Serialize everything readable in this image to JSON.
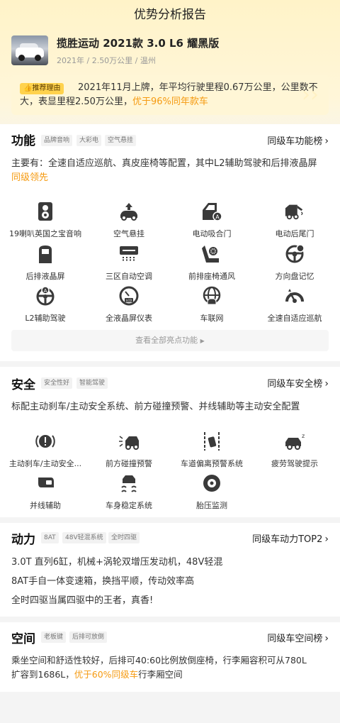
{
  "header": {
    "title": "优势分析报告"
  },
  "car": {
    "name": "揽胜运动 2021款 3.0 L6 耀黑版",
    "meta": "2021年 / 2.50万公里 / 温州"
  },
  "recommend": {
    "badge": "推荐理由",
    "line1": "2021年11月上牌，年平均行驶里程0.67万公里，公里数不",
    "line2_a": "大，表显里程2.50万公里，",
    "line2_hl": "优于96%同年款车"
  },
  "features": {
    "title": "功能",
    "tags": [
      "品牌音响",
      "大彩电",
      "空气悬挂"
    ],
    "rank": "同级车功能榜",
    "summary_line1": "主要有：全速自适应巡航、真皮座椅等配置，其中L2辅助驾驶和后排液晶屏",
    "summary_hl": "同级领先",
    "items": [
      {
        "label": "19喇叭英国之宝音响",
        "icon": "speaker-icon"
      },
      {
        "label": "空气悬挂",
        "icon": "air-suspension-icon"
      },
      {
        "label": "电动吸合门",
        "icon": "power-door-icon"
      },
      {
        "label": "电动后尾门",
        "icon": "power-tailgate-icon"
      },
      {
        "label": "后排液晶屏",
        "icon": "rear-screen-icon"
      },
      {
        "label": "三区自动空调",
        "icon": "climate-icon"
      },
      {
        "label": "前排座椅通风",
        "icon": "seat-ventilation-icon"
      },
      {
        "label": "方向盘记忆",
        "icon": "steering-memory-icon"
      },
      {
        "label": "L2辅助驾驶",
        "icon": "assist-driving-icon"
      },
      {
        "label": "全液晶屏仪表",
        "icon": "lcd-cluster-icon"
      },
      {
        "label": "车联网",
        "icon": "connected-car-icon"
      },
      {
        "label": "全速自适应巡航",
        "icon": "adaptive-cruise-icon"
      }
    ],
    "more": "查看全部亮点功能"
  },
  "safety": {
    "title": "安全",
    "tags": [
      "安全性好",
      "智能驾驶"
    ],
    "rank": "同级车安全榜",
    "summary": "标配主动刹车/主动安全系统、前方碰撞预警、并线辅助等主动安全配置",
    "items": [
      {
        "label": "主动刹车/主动安全...",
        "icon": "active-brake-icon"
      },
      {
        "label": "前方碰撞预警",
        "icon": "collision-warning-icon"
      },
      {
        "label": "车道偏离预警系统",
        "icon": "lane-departure-icon"
      },
      {
        "label": "疲劳驾驶提示",
        "icon": "fatigue-alert-icon"
      },
      {
        "label": "并线辅助",
        "icon": "blind-spot-icon"
      },
      {
        "label": "车身稳定系统",
        "icon": "stability-control-icon"
      },
      {
        "label": "胎压监测",
        "icon": "tire-pressure-icon"
      }
    ]
  },
  "power": {
    "title": "动力",
    "tags": [
      "8AT",
      "48V轻混系统",
      "全时四驱"
    ],
    "rank": "同级车动力TOP2",
    "lines": [
      "3.0T 直列6缸，机械+涡轮双增压发动机，48V轻混",
      "8AT手自一体变速箱，换挡平顺，传动效率高",
      "全时四驱当属四驱中的王者，真香!"
    ]
  },
  "space": {
    "title": "空间",
    "tags": [
      "老板键",
      "后排可放倒"
    ],
    "rank": "同级车空间榜",
    "line1": "乘坐空间和舒适性较好，后排可40:60比例放倒座椅，行李厢容积可从780L",
    "line2_a": "扩容到1686L，",
    "line2_hl": "优于60%同级车",
    "line2_b": "行李厢空间"
  },
  "colors": {
    "accent": "#f59a10",
    "badge": "#ffd24d",
    "icon": "#3a3a3a"
  }
}
